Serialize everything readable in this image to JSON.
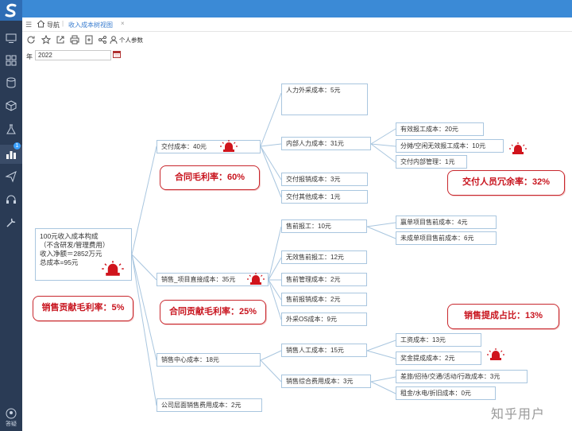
{
  "sidebar": {
    "bottom_label": "答疑"
  },
  "tabs": {
    "nav_label": "导航",
    "active_label": "收入成本树视图",
    "close_glyph": "×"
  },
  "toolbar": {
    "params_label": "个人参数"
  },
  "filter": {
    "year_label": "年",
    "year_value": "2022"
  },
  "tree": {
    "root": {
      "line1": "100元收入成本构成",
      "line2": "（不含研发/管理费用）",
      "line3": "收入净额＝2852万元",
      "line4": "总成本=95元"
    },
    "l1": {
      "delivery": "交付成本：40元",
      "sales_project": "销售_项目直接成本：35元",
      "sales_center": "销售中心成本：18元",
      "company": "公司层面销售费用成本：2元"
    },
    "l2": {
      "hr_outsource": "人力外采成本：5元",
      "hr_internal": "内部人力成本：31元",
      "delivery_reimb": "交付报销成本：3元",
      "delivery_other": "交付其他成本：1元",
      "presales_report": "售前报工：10元",
      "invalid_report": "无效售前报工：12元",
      "presales_mgmt": "售前管理成本：2元",
      "presales_reimb": "售前报销成本：2元",
      "outsource_os": "外采OS成本：9元",
      "sales_labor": "销售人工成本：15元",
      "sales_misc": "销售综合费用成本：3元"
    },
    "l3": {
      "valid_report": "有效报工成本：20元",
      "idle_report": "分摊/空闲无效报工成本：10元",
      "delivery_dept": "交付内部管理：1元",
      "won_presales": "赢单项目售前成本：4元",
      "lost_presales": "未成单项目售前成本：6元",
      "salary": "工资成本：13元",
      "bonus": "奖金提成成本：2元",
      "travel": "差旅/招待/交通/活动/行政成本：3元",
      "rent": "租金/水电/折旧成本：0元"
    }
  },
  "callouts": {
    "contract_margin": "合同毛利率：60%",
    "delivery_redundancy": "交付人员冗余率：32%",
    "sales_margin": "销售贡献毛利率：5%",
    "contract_contribution": "合同贡献毛利率：25%",
    "sales_commission": "销售提成占比：13%"
  },
  "watermark": "知乎用户",
  "colors": {
    "sidebar": "#2a3b55",
    "topbar": "#3b8ad6",
    "node_border": "#a9c6df",
    "callout": "#c8272d",
    "alarm": "#d0141c"
  }
}
